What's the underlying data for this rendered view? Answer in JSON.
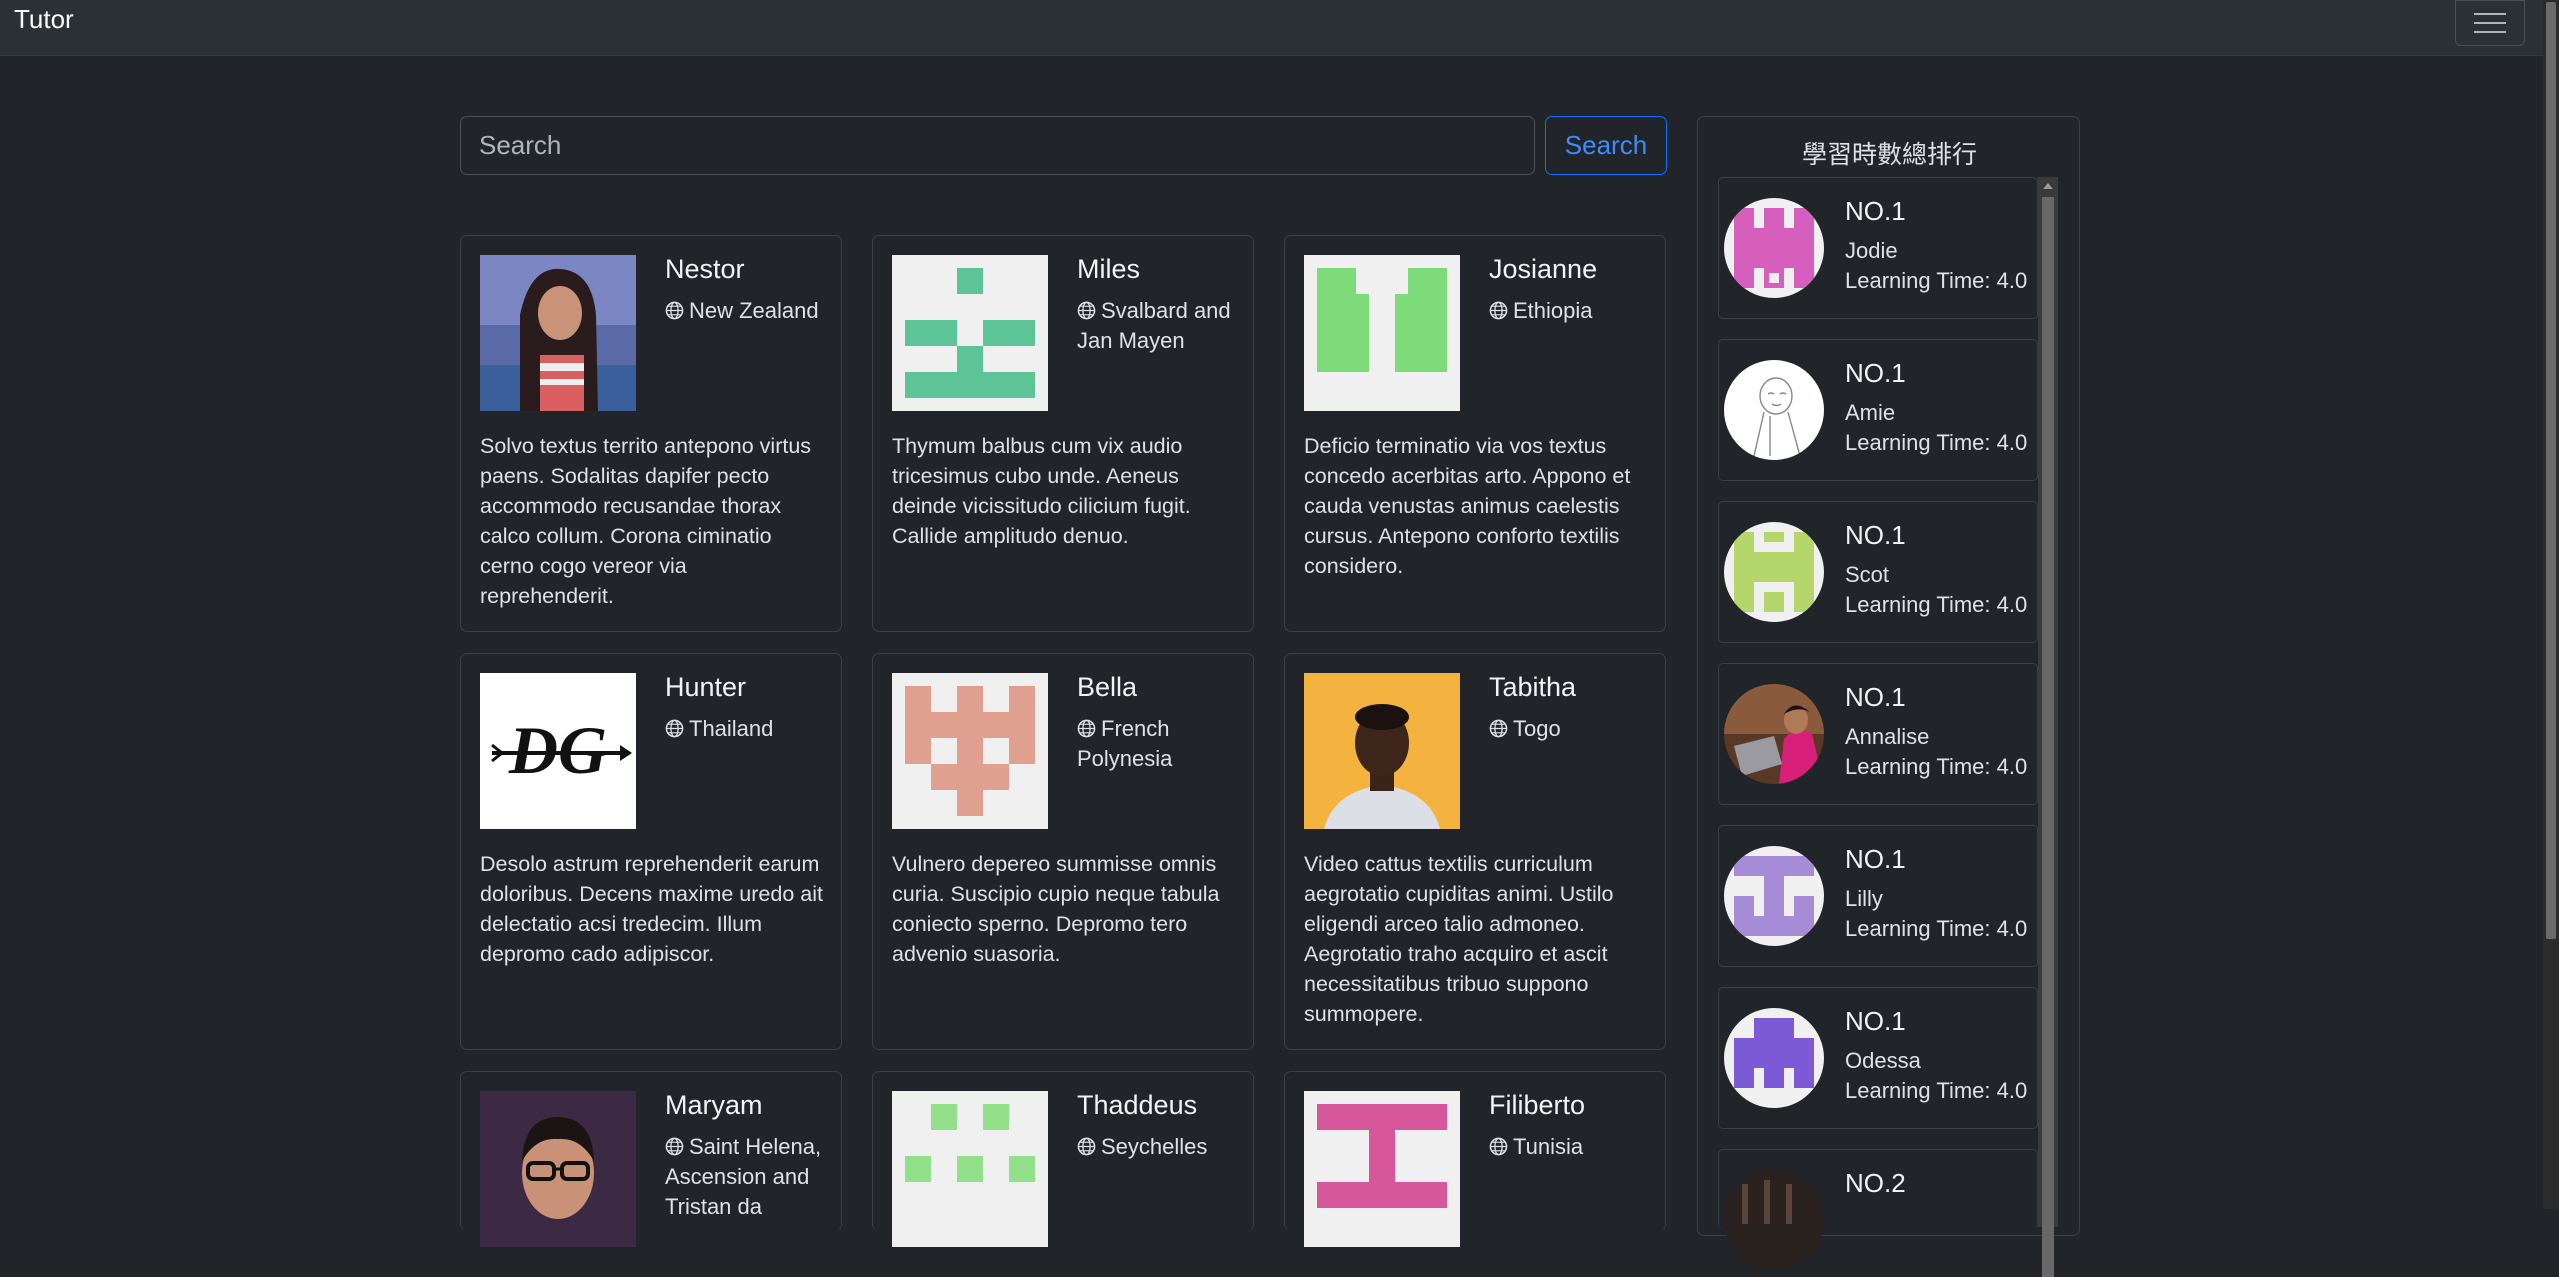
{
  "navbar": {
    "brand": "Tutor",
    "menu_icon": "hamburger-icon"
  },
  "search": {
    "placeholder": "Search",
    "button_label": "Search"
  },
  "tutors": [
    {
      "name": "Nestor",
      "country": "New Zealand",
      "avatar": "photo-woman",
      "description": "Solvo textus territo antepono virtus paens. Sodalitas dapifer pecto accommodo recusandae thorax calco collum. Corona ciminatio cerno cogo vereor via reprehenderit."
    },
    {
      "name": "Miles",
      "country": "Svalbard and Jan Mayen",
      "avatar": "identicon-green",
      "description": "Thymum balbus cum vix audio tricesimus cubo unde. Aeneus deinde vicissitudo cilicium fugit. Callide amplitudo denuo."
    },
    {
      "name": "Josianne",
      "country": "Ethiopia",
      "avatar": "identicon-lightgreen",
      "description": "Deficio terminatio via vos textus concedo acerbitas arto. Appono et cauda venustas animus caelestis cursus. Antepono conforto textilis considero."
    },
    {
      "name": "Hunter",
      "country": "Thailand",
      "avatar": "logo-dg",
      "description": "Desolo astrum reprehenderit earum doloribus. Decens maxime uredo ait delectatio acsi tredecim. Illum depromo cado adipiscor."
    },
    {
      "name": "Bella",
      "country": "French Polynesia",
      "avatar": "identicon-salmon",
      "description": "Vulnero depereo summisse omnis curia. Suscipio cupio neque tabula coniecto sperno. Depromo tero advenio suasoria."
    },
    {
      "name": "Tabitha",
      "country": "Togo",
      "avatar": "photo-man-orange",
      "description": "Video cattus textilis curriculum aegrotatio cupiditas animi. Ustilo eligendi arceo talio admoneo. Aegrotatio traho acquiro et ascit necessitatibus tribuo suppono summopere."
    },
    {
      "name": "Maryam",
      "country": "Saint Helena, Ascension and Tristan da",
      "avatar": "photo-man-glasses",
      "description": ""
    },
    {
      "name": "Thaddeus",
      "country": "Seychelles",
      "avatar": "identicon-mint",
      "description": ""
    },
    {
      "name": "Filiberto",
      "country": "Tunisia",
      "avatar": "identicon-pink",
      "description": ""
    }
  ],
  "ranking": {
    "title": "學習時數總排行",
    "items": [
      {
        "rank": "NO.1",
        "name": "Jodie",
        "time": "Learning Time: 4.0",
        "avatar": "identicon-pink"
      },
      {
        "rank": "NO.1",
        "name": "Amie",
        "time": "Learning Time: 4.0",
        "avatar": "sketch-white"
      },
      {
        "rank": "NO.1",
        "name": "Scot",
        "time": "Learning Time: 4.0",
        "avatar": "identicon-lime"
      },
      {
        "rank": "NO.1",
        "name": "Annalise",
        "time": "Learning Time: 4.0",
        "avatar": "photo-laptop"
      },
      {
        "rank": "NO.1",
        "name": "Lilly",
        "time": "Learning Time: 4.0",
        "avatar": "identicon-lavender"
      },
      {
        "rank": "NO.1",
        "name": "Odessa",
        "time": "Learning Time: 4.0",
        "avatar": "identicon-purple"
      },
      {
        "rank": "NO.2",
        "name": "",
        "time": "",
        "avatar": "photo-dark"
      }
    ]
  },
  "colors": {
    "background": "#212529",
    "navbar": "#2b3035",
    "border": "#3a3f45",
    "accent_blue": "#0d6efd",
    "text": "#dee2e6"
  }
}
